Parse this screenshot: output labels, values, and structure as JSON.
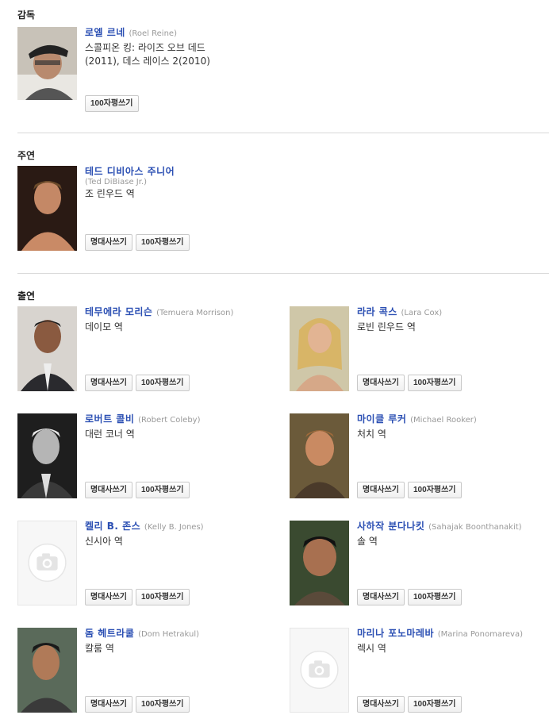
{
  "sections": {
    "director": "감독",
    "starring": "주연",
    "cast": "출연"
  },
  "buttons": {
    "quote": "명대사쓰기",
    "review": "100자평쓰기"
  },
  "director": {
    "name": "로엘 르네",
    "orig": "(Roel Reine)",
    "works_line1": "스콜피온 킹: 라이즈 오브 데드",
    "works_line2": "(2011), 데스 레이스 2(2010)"
  },
  "lead": {
    "name": "테드 디비아스 주니어",
    "orig": "(Ted DiBiase Jr.)",
    "role": "조 린우드 역"
  },
  "cast": [
    {
      "name": "테무에라 모리슨",
      "orig": "(Temuera Morrison)",
      "role": "데이모 역"
    },
    {
      "name": "라라 콕스",
      "orig": "(Lara Cox)",
      "role": "로빈 린우드 역"
    },
    {
      "name": "로버트 콜비",
      "orig": "(Robert Coleby)",
      "role": "대런 코너 역"
    },
    {
      "name": "마이클 루커",
      "orig": "(Michael Rooker)",
      "role": "처치 역"
    },
    {
      "name": "켈리 B. 존스",
      "orig": "(Kelly B. Jones)",
      "role": "신시아 역"
    },
    {
      "name": "사하작 분다나킷",
      "orig": "(Sahajak Boonthanakit)",
      "role": "솔 역"
    },
    {
      "name": "돔 헤트라쿨",
      "orig": "(Dom Hetrakul)",
      "role": "칼룸 역"
    },
    {
      "name": "마리나 포노마레바",
      "orig": "(Marina Ponomareva)",
      "role": "렉시 역"
    }
  ]
}
